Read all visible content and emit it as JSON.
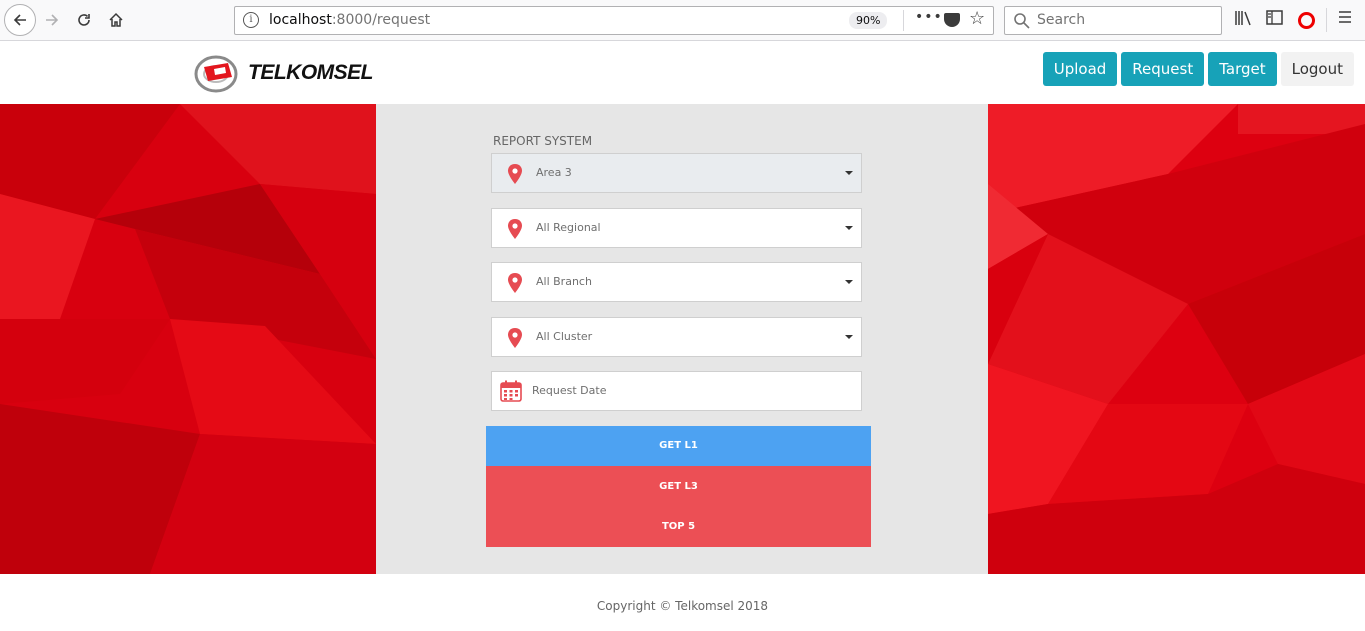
{
  "browser": {
    "url_host": "localhost",
    "url_path": ":8000/request",
    "zoom": "90%",
    "search_placeholder": "Search"
  },
  "header": {
    "brand": "TELKOMSEL",
    "nav": {
      "upload": "Upload",
      "request": "Request",
      "target": "Target",
      "logout": "Logout"
    }
  },
  "form": {
    "title": "REPORT SYSTEM",
    "area": "Area 3",
    "regional": "All Regional",
    "branch": "All Branch",
    "cluster": "All Cluster",
    "date_placeholder": "Request Date",
    "buttons": {
      "l1": "GET L1",
      "l3": "GET L3",
      "top5": "TOP 5"
    }
  },
  "footer": {
    "copyright": "Copyright © Telkomsel 2018"
  },
  "colors": {
    "nav_button": "#17a2b8",
    "accent_red": "#ec4f55",
    "accent_blue": "#4da2f2",
    "bg_red": "#d8000f"
  }
}
